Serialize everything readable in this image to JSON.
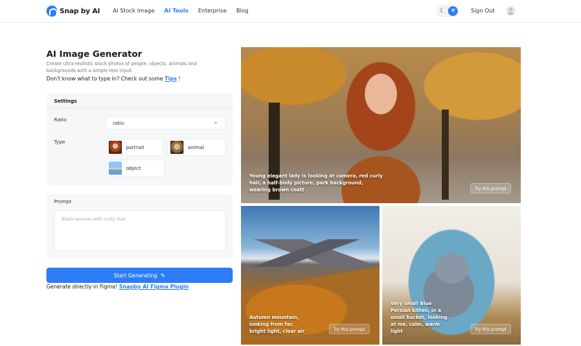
{
  "header": {
    "brand": "Snap by AI",
    "nav": [
      "AI Stock Image",
      "AI Tools",
      "Enterprise",
      "Blog"
    ],
    "active_nav": "AI Tools",
    "theme_moon": "☾",
    "theme_sun": "☀",
    "sign_out": "Sign Out"
  },
  "generator": {
    "title": "AI Image Generator",
    "description": "Create ultra-realistic stock photos of people, objects, animals and backgrounds with a simple text input.",
    "tips_prefix": "Don't know what to type in? Check out some",
    "tips_link": "Tips",
    "tips_suffix": "!",
    "settings_title": "Settings",
    "ratio_label": "Ratio",
    "ratio_value": "ratio",
    "type_label": "Type",
    "types": [
      {
        "label": "portrait"
      },
      {
        "label": "animal"
      },
      {
        "label": "object"
      }
    ],
    "prompt_label": "Prompt",
    "prompt_placeholder": "Black woman with curly Hair",
    "start_button": "Start Generating",
    "figma_prefix": "Generate directly in Figma!",
    "figma_link": "Snapby AI Figma Plugin"
  },
  "gallery": [
    {
      "caption": "Young elegant lady is looking at camera, red curly hair, a half-body picture, park background, wearing brown coatt",
      "action": "Try this prompt"
    },
    {
      "caption": "Autumn mountain, looking from far, bright light, clear air",
      "action": "Try this prompt"
    },
    {
      "caption": "Very small Blue Persian kitten, in a small bucket, looking at me, calm, warm light",
      "action": "Try this prompt"
    }
  ],
  "colors": {
    "accent": "#2f7df6",
    "panel": "#f6f7f9"
  }
}
